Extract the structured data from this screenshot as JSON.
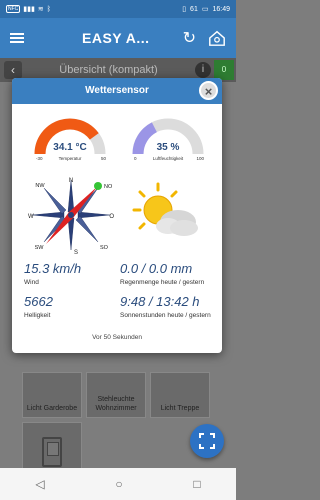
{
  "statusbar": {
    "left_badge": "NFC",
    "battery": "61",
    "time": "16:49"
  },
  "appbar": {
    "title": "EASY A..."
  },
  "subheader": {
    "title": "Übersicht (kompakt)",
    "info": "i",
    "count": "0"
  },
  "modal": {
    "title": "Wettersensor",
    "close": "×",
    "temp_gauge": {
      "value": "34.1 °C",
      "caption": "Temperatur",
      "min": "-30",
      "max": "50",
      "level": 0.8
    },
    "hum_gauge": {
      "value": "35 %",
      "caption": "Luftfeuchtigkeit",
      "min": "0",
      "max": "100",
      "level": 0.35
    },
    "compass": {
      "n": "N",
      "no": "NO",
      "o": "O",
      "so": "SO",
      "s": "S",
      "sw": "SW",
      "w": "W",
      "nw": "NW"
    },
    "wind": {
      "value": "15.3 km/h",
      "label": "Wind"
    },
    "rain": {
      "value": "0.0 / 0.0 mm",
      "label": "Regenmenge heute / gestern"
    },
    "brightness": {
      "value": "5662",
      "label": "Helligkeit"
    },
    "sun": {
      "value": "9:48 / 13:42 h",
      "label": "Sonnenstunden heute / gestern"
    },
    "footer": "Vor 50 Sekunden"
  },
  "tiles": [
    {
      "label": "Licht Garderobe"
    },
    {
      "label": "Stehleuchte Wohnzimmer"
    },
    {
      "label": "Licht Treppe"
    }
  ],
  "colors": {
    "accent": "#3a7fc0",
    "temp": "#f05a14",
    "hum": "#9b95e6"
  }
}
